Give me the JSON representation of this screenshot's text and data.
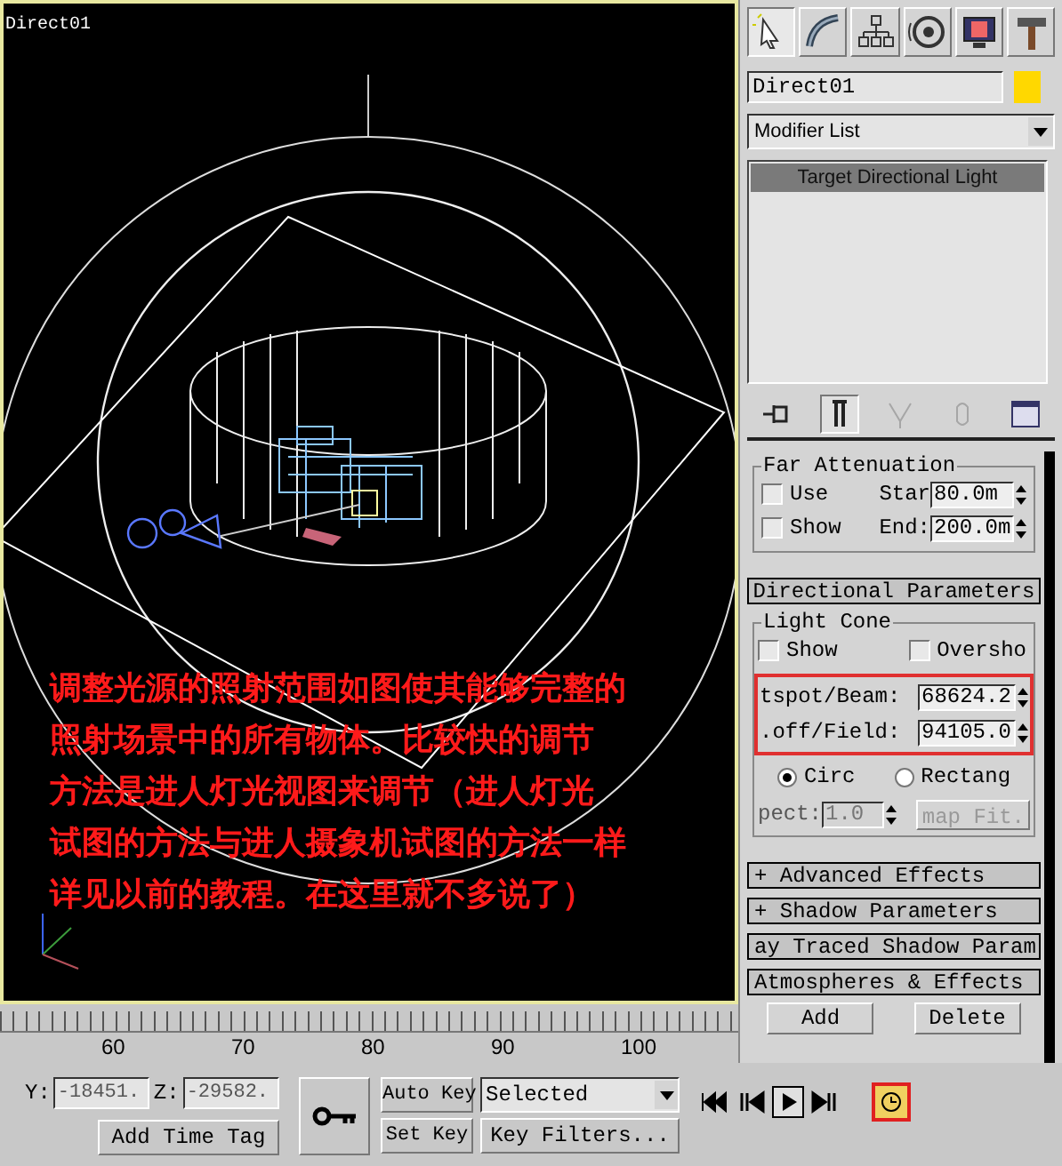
{
  "viewport": {
    "label": "Direct01",
    "annotation_lines": [
      "调整光源的照射范围如图使其能够完整的",
      "照射场景中的所有物体。比较快的调节",
      "方法是进人灯光视图来调节（进人灯光",
      "试图的方法与进人摄象机试图的方法一样",
      "详见以前的教程。在这里就不多说了）"
    ]
  },
  "command_tabs": [
    {
      "kind": "create",
      "selected": true
    },
    {
      "kind": "modify",
      "selected": false
    },
    {
      "kind": "hierarchy",
      "selected": false
    },
    {
      "kind": "motion",
      "selected": false
    },
    {
      "kind": "display",
      "selected": false
    },
    {
      "kind": "utilities",
      "selected": false
    }
  ],
  "object": {
    "name": "Direct01",
    "color": "#ffd800"
  },
  "modifier_list": {
    "label": "Modifier List"
  },
  "stack": [
    {
      "label": "Target Directional Light",
      "selected": true
    }
  ],
  "stack_tools": [
    {
      "kind": "pin",
      "disabled": false,
      "selected": false
    },
    {
      "kind": "show-end",
      "disabled": false,
      "selected": true
    },
    {
      "kind": "unique",
      "disabled": true,
      "selected": false
    },
    {
      "kind": "remove",
      "disabled": true,
      "selected": false
    },
    {
      "kind": "configure",
      "disabled": false,
      "selected": false
    }
  ],
  "far_attenuation": {
    "title": "Far Attenuation",
    "use": {
      "label": "Use",
      "checked": false
    },
    "show": {
      "label": "Show",
      "checked": false
    },
    "start": {
      "label": "Star",
      "value": "80.0m"
    },
    "end": {
      "label": "End:",
      "value": "200.0m"
    }
  },
  "directional_parameters": {
    "title": "Directional Parameters",
    "light_cone": "Light Cone",
    "show": {
      "label": "Show",
      "checked": false
    },
    "overshoot": {
      "label": "Oversho",
      "checked": false
    },
    "hotspot": {
      "label": "tspot/Beam:",
      "value": "68624.2"
    },
    "falloff": {
      "label": ".off/Field:",
      "value": "94105.0"
    },
    "shape": [
      {
        "label": "Circ",
        "selected": true
      },
      {
        "label": "Rectang",
        "selected": false
      }
    ],
    "aspect": {
      "label": "pect:",
      "value": "1.0",
      "disabled": true
    },
    "bitmap_fit": {
      "label": "map Fit.",
      "disabled": true
    }
  },
  "rollouts": [
    {
      "label": "+  Advanced Effects"
    },
    {
      "label": "+ Shadow Parameters"
    },
    {
      "label": "ay Traced Shadow Param"
    },
    {
      "label": "Atmospheres & Effects"
    }
  ],
  "atmosphere_buttons": [
    "Add",
    "Delete"
  ],
  "timeline": {
    "ticks": [
      "60",
      "70",
      "80",
      "90",
      "100"
    ]
  },
  "coordinates": [
    {
      "label": "Y:",
      "value": "-18451."
    },
    {
      "label": "Z:",
      "value": "-29582."
    }
  ],
  "add_time_tag": "Add Time Tag",
  "auto_key": "Auto Key",
  "set_key": "Set Key",
  "key_mode": "Selected",
  "key_filters": "Key Filters...",
  "playback": [
    {
      "kind": "first",
      "selected": false
    },
    {
      "kind": "prev",
      "selected": false
    },
    {
      "kind": "play",
      "selected": true
    },
    {
      "kind": "next",
      "selected": false
    }
  ]
}
